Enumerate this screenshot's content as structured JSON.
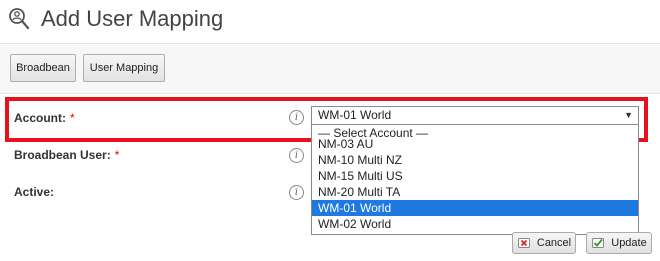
{
  "header": {
    "title": "Add User Mapping",
    "icon": "user-search-icon"
  },
  "toolbar": {
    "broadbean_label": "Broadbean",
    "user_mapping_label": "User Mapping"
  },
  "form": {
    "account": {
      "label": "Account:",
      "required_mark": "*",
      "selected_value": "WM-01 World"
    },
    "broadbean_user": {
      "label": "Broadbean User:",
      "required_mark": "*"
    },
    "active": {
      "label": "Active:"
    },
    "info_glyph": "i"
  },
  "account_dropdown": {
    "options": [
      "— Select Account —",
      "NM-03 AU",
      "NM-10 Multi NZ",
      "NM-15 Multi US",
      "NM-20 Multi TA",
      "WM-01 World",
      "WM-02 World"
    ],
    "highlighted": "WM-01 World"
  },
  "actions": {
    "cancel_label": "Cancel",
    "update_label": "Update"
  },
  "colors": {
    "highlight_border": "#e8101a",
    "selected_option_bg": "#1e7ae0",
    "required": "#ee0000"
  }
}
